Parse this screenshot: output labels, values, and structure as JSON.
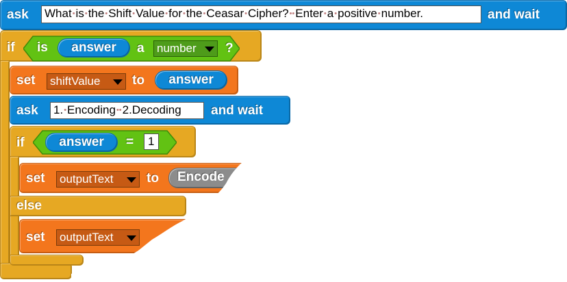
{
  "ask_block_1": {
    "keyword": "ask",
    "prompt_words": [
      "What",
      "is",
      "the",
      "Shift",
      "Value",
      "for",
      "the",
      "Ceasar",
      "Cipher?",
      "",
      "Enter",
      "a",
      "positive",
      "number."
    ],
    "suffix": "and wait"
  },
  "if_outer": {
    "keyword": "if",
    "is_label": "is",
    "reporter": "answer",
    "article": "a",
    "type_dropdown": "number",
    "question_mark": "?"
  },
  "set_shift": {
    "keyword": "set",
    "variable": "shiftValue",
    "to_label": "to",
    "value_reporter": "answer"
  },
  "ask_block_2": {
    "keyword": "ask",
    "prompt_words": [
      "1.",
      "Encoding",
      "",
      "2.Decoding"
    ],
    "suffix": "and wait"
  },
  "if_inner": {
    "keyword": "if",
    "reporter": "answer",
    "operator": "=",
    "compare_value": "1",
    "else_label": "else"
  },
  "set_output_1": {
    "keyword": "set",
    "variable": "outputText",
    "to_label": "to",
    "value_reporter": "Encode"
  },
  "set_output_2": {
    "keyword": "set",
    "variable": "outputText"
  },
  "colors": {
    "sensing": "#0e88d6",
    "control": "#e6a823",
    "variables": "#f3761d",
    "operators": "#62c213",
    "custom_reporter": "#8c8c8c"
  }
}
